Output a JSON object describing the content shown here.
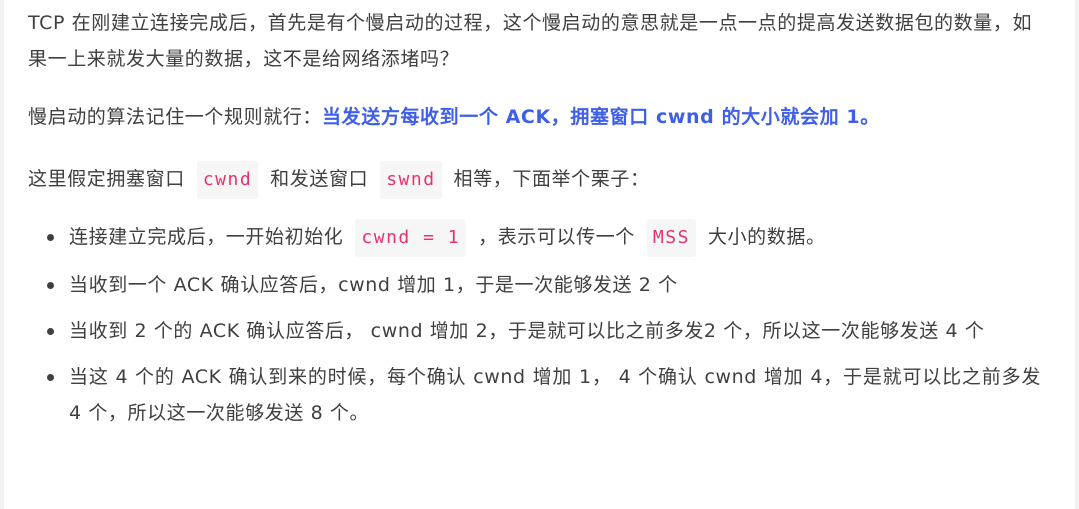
{
  "paragraph1": "TCP 在刚建立连接完成后，首先是有个慢启动的过程，这个慢启动的意思就是一点一点的提高发送数据包的数量，如果一上来就发大量的数据，这不是给网络添堵吗？",
  "paragraph2": {
    "prefix": "慢启动的算法记住一个规则就行：",
    "emphasis": "当发送方每收到一个 ACK，拥塞窗口 cwnd 的大小就会加 1。"
  },
  "paragraph3": {
    "text1": "这里假定拥塞窗口",
    "code1": "cwnd",
    "text2": "和发送窗口",
    "code2": "swnd",
    "text3": "相等，下面举个栗子："
  },
  "list": {
    "item1": {
      "text1": "连接建立完成后，一开始初始化",
      "code1": "cwnd = 1",
      "text2": "，表示可以传一个",
      "code2": "MSS",
      "text3": "大小的数据。"
    },
    "item2": "当收到一个 ACK 确认应答后，cwnd 增加 1，于是一次能够发送 2 个",
    "item3": "当收到 2 个的 ACK 确认应答后， cwnd 增加 2，于是就可以比之前多发2 个，所以这一次能够发送 4 个",
    "item4": "当这 4 个的 ACK 确认到来的时候，每个确认 cwnd 增加 1， 4 个确认 cwnd 增加 4，于是就可以比之前多发 4 个，所以这一次能够发送 8 个。"
  }
}
